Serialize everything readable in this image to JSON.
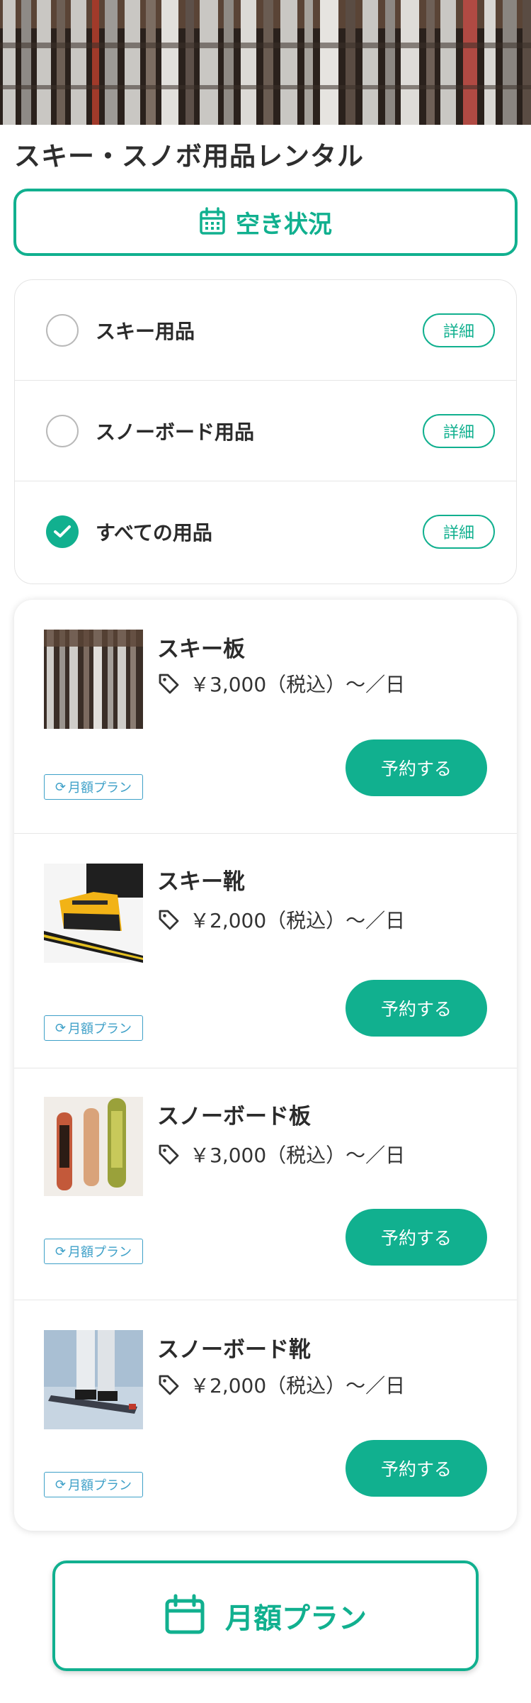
{
  "hero": {
    "image": "ski-rental-rack-photo"
  },
  "page_title": "スキー・スノボ用品レンタル",
  "availability_button": {
    "label": "空き状況",
    "icon": "calendar-icon"
  },
  "categories": [
    {
      "label": "スキー用品",
      "checked": false,
      "detail_label": "詳細"
    },
    {
      "label": "スノーボード用品",
      "checked": false,
      "detail_label": "詳細"
    },
    {
      "label": "すべての用品",
      "checked": true,
      "detail_label": "詳細"
    }
  ],
  "products": [
    {
      "name": "スキー板",
      "price": "￥3,000（税込）〜／日",
      "reserve_label": "予約する",
      "plan_badge": "月額プラン",
      "thumb": "skis-photo"
    },
    {
      "name": "スキー靴",
      "price": "￥2,000（税込）〜／日",
      "reserve_label": "予約する",
      "plan_badge": "月額プラン",
      "thumb": "ski-boot-photo"
    },
    {
      "name": "スノーボード板",
      "price": "￥3,000（税込）〜／日",
      "reserve_label": "予約する",
      "plan_badge": "月額プラン",
      "thumb": "snowboards-photo"
    },
    {
      "name": "スノーボード靴",
      "price": "￥2,000（税込）〜／日",
      "reserve_label": "予約する",
      "plan_badge": "月額プラン",
      "thumb": "snowboarder-photo"
    }
  ],
  "monthly_plan_button": {
    "label": "月額プラン",
    "icon": "calendar-icon"
  },
  "colors": {
    "accent": "#11b08f",
    "badge": "#3ea0c8",
    "text": "#2b2b2b"
  }
}
